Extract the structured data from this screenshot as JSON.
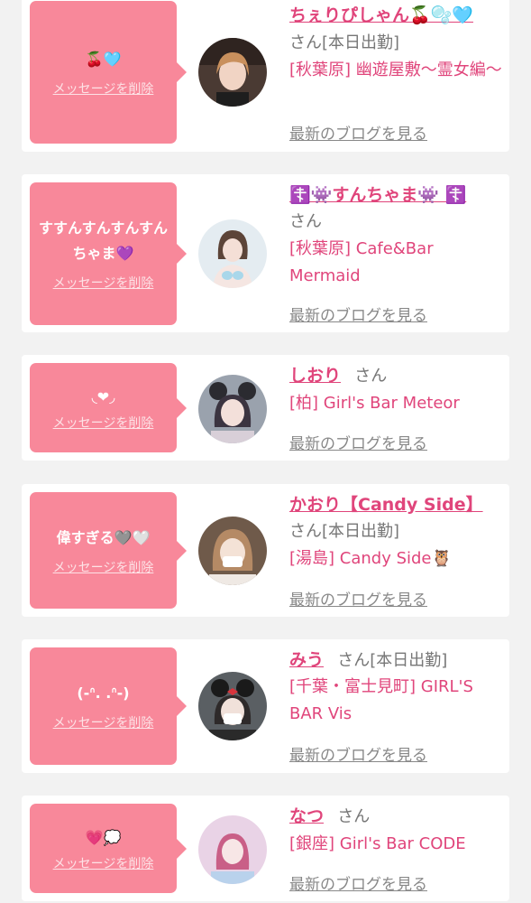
{
  "cards": [
    {
      "message": "🍒🩵",
      "delete_label": "メッセージを削除",
      "name": "ちぇりぴしゃん🍒🫧🩵",
      "suffix": "さん[本日出勤]",
      "shop": "[秋葉原] 幽遊屋敷〜霊女編〜",
      "blog_label": "最新のブログを見る",
      "avatar_color": "#4a3a33"
    },
    {
      "message": "すすんすんすんすんちゃま💜",
      "delete_label": "メッセージを削除",
      "name": "☦️👾すんちゃま👾 ☦️",
      "suffix": "さん",
      "shop": "[秋葉原] Cafe&Bar Mermaid",
      "blog_label": "最新のブログを見る",
      "avatar_color": "#dfe8ee"
    },
    {
      "message": "◟❤︎◞",
      "delete_label": "メッセージを削除",
      "name": "しおり",
      "suffix": "さん",
      "shop": "[柏] Girl's Bar Meteor",
      "blog_label": "最新のブログを見る",
      "avatar_color": "#8a8f9a"
    },
    {
      "message": "偉すぎる🩶🤍",
      "delete_label": "メッセージを削除",
      "name": "かおり【Candy Side】",
      "suffix": "さん[本日出勤]",
      "shop": "[湯島] Candy Side🦉",
      "blog_label": "最新のブログを見る",
      "avatar_color": "#6a5546"
    },
    {
      "message": "(-ᐢ. .ᐢ-)",
      "delete_label": "メッセージを削除",
      "name": "みう",
      "suffix": "さん[本日出勤]",
      "shop": "[千葉・富士見町] GIRL'S BAR Vis",
      "blog_label": "最新のブログを見る",
      "avatar_color": "#3d3d40"
    },
    {
      "message": "💗💭",
      "delete_label": "メッセージを削除",
      "name": "なつ",
      "suffix": "さん",
      "shop": "[銀座] Girl's Bar CODE",
      "blog_label": "最新のブログを見る",
      "avatar_color": "#d9b8d6"
    }
  ]
}
